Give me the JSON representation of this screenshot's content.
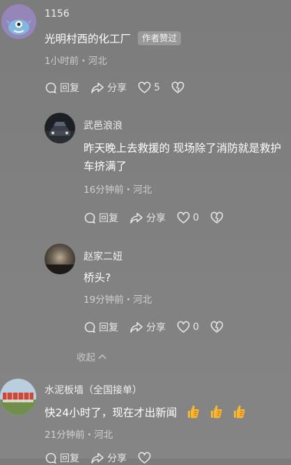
{
  "comments": [
    {
      "username": "1156",
      "content": "光明村西的化工厂",
      "badge": "作者赞过",
      "meta": "1小时前・河北",
      "reply_label": "回复",
      "share_label": "分享",
      "like_count": "5"
    },
    {
      "username": "武邑浪浪",
      "content": "昨天晚上去救援的 现场除了消防就是救护车挤满了",
      "meta": "16分钟前・河北",
      "reply_label": "回复",
      "share_label": "分享",
      "like_count": "0"
    },
    {
      "username": "赵家二妞",
      "content": "桥头?",
      "meta": "19分钟前・河北",
      "reply_label": "回复",
      "share_label": "分享",
      "like_count": "0"
    },
    {
      "username": "水泥板墙（全国接单）",
      "content": "快24小时了，现在才出新闻",
      "meta": "21分钟前・河北",
      "reply_label": "回复",
      "share_label": "分享",
      "emoji_icons": [
        "thumbs-up-icon",
        "thumbs-up-icon",
        "thumbs-up-icon"
      ]
    }
  ],
  "collapse_label": "收起",
  "colors": {
    "background": "#808080",
    "text_primary": "#ffffff",
    "emoji": "#f5b82e"
  }
}
